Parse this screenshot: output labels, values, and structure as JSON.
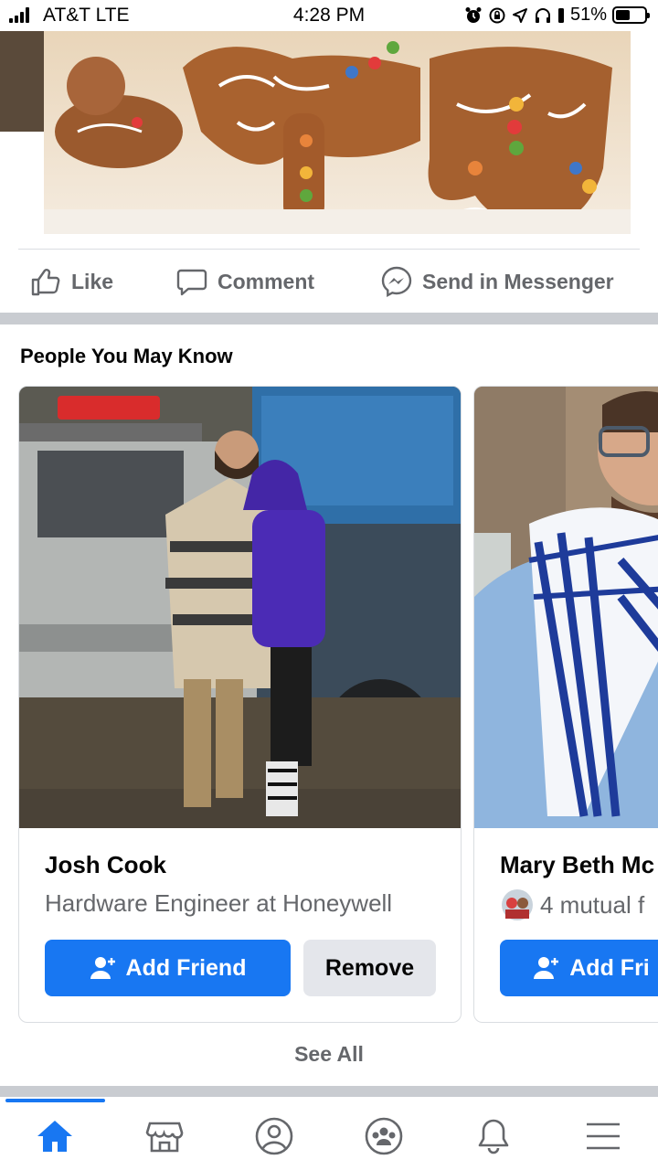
{
  "status_bar": {
    "carrier": "AT&T LTE",
    "time": "4:28 PM",
    "battery": "51%",
    "battery_level": 0.51
  },
  "post": {
    "actions": [
      {
        "label": "Like",
        "icon": "thumbs-up-icon"
      },
      {
        "label": "Comment",
        "icon": "comment-bubble-icon"
      },
      {
        "label": "Send in Messenger",
        "icon": "messenger-icon"
      }
    ]
  },
  "pymk": {
    "title": "People You May Know",
    "cards": [
      {
        "name": "Josh Cook",
        "subtitle": "Hardware Engineer at Honeywell",
        "add_label": "Add Friend",
        "remove_label": "Remove"
      },
      {
        "name": "Mary Beth Mc",
        "subtitle": "4 mutual f",
        "add_label": "Add Fri"
      }
    ],
    "see_all": "See All"
  },
  "bottom_nav": {
    "items": [
      "home-icon",
      "marketplace-icon",
      "profile-icon",
      "groups-icon",
      "notifications-icon",
      "menu-icon"
    ],
    "active": "home-icon"
  },
  "colors": {
    "accent": "#1877f2",
    "secondary_text": "#65676b",
    "button_gray": "#e4e6eb"
  }
}
